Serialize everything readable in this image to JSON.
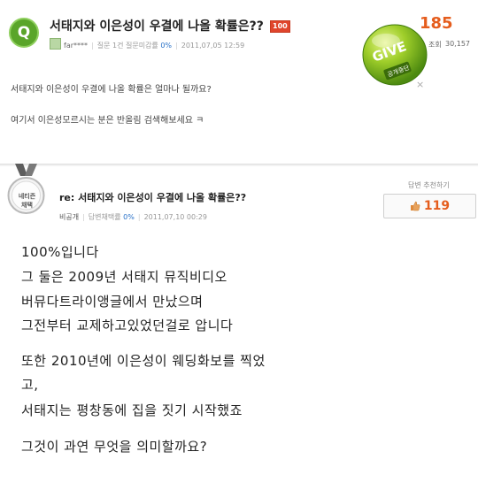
{
  "question": {
    "icon_letter": "Q",
    "title": "서태지와 이은성이 우결에 나올 확률은??",
    "badge": "100",
    "author": "far****",
    "meta_parts": [
      "질문 1건",
      "질문미감률"
    ],
    "meta_pct": "0%",
    "date": "2011,07,05 12:59",
    "count": "185",
    "views_label": "조회",
    "views": "30,157",
    "gem_label": "GIVE",
    "gem_tag": "공개중단",
    "close": "×",
    "body": [
      "서태지와 이은성이 우결에 나올 확률은 얼마나 될까요?",
      "여기서 이은성모르시는 분은 반올림 검색해보세요 ㅋ"
    ]
  },
  "answer": {
    "medal_text": [
      "네티즌",
      "채택"
    ],
    "title": "re: 서태지와 이은성이 우결에 나올 확률은??",
    "author": "비공개",
    "meta_label": "답변채택률",
    "meta_pct": "0%",
    "date": "2011,07,10 00:29",
    "recommend_label": "답변 추천하기",
    "recommend_count": "119",
    "body": [
      "100%입니다",
      "그 둘은 2009년 서태지 뮤직비디오",
      "버뮤다트라이앵글에서 만났으며",
      "그전부터 교제하고있었던걸로 압니다",
      "또한 2010년에 이은성이 웨딩화보를 찍었",
      "고,",
      "서태지는 평창동에 집을 짓기 시작했죠",
      "그것이 과연 무엇을 의미할까요?"
    ]
  },
  "colors": {
    "accent_green": "#5aa52a",
    "accent_orange": "#e55d1d",
    "link_blue": "#2a72c8"
  },
  "icons": [
    "q-icon",
    "medal-icon",
    "thumb-up-icon",
    "gem-icon",
    "close-icon",
    "avatar-icon"
  ]
}
